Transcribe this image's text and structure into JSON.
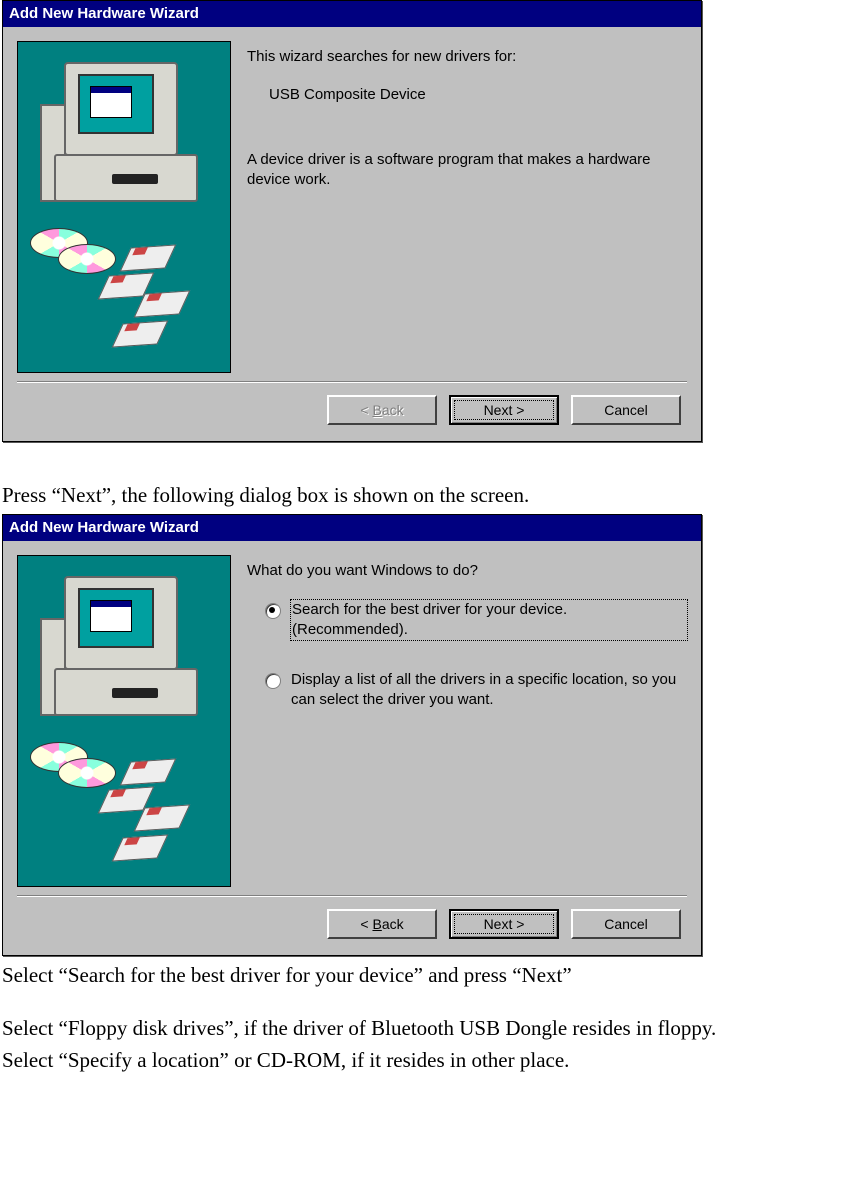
{
  "dialog1": {
    "title": "Add New Hardware Wizard",
    "line1": "This wizard searches for new drivers for:",
    "device": "USB Composite Device",
    "line2": "A device driver is a software program that makes a hardware device work.",
    "back_prefix": "< ",
    "back_u": "B",
    "back_suffix": "ack",
    "next": "Next >",
    "cancel": "Cancel"
  },
  "caption1": "Press “Next”, the following dialog box is shown on the screen.",
  "dialog2": {
    "title": "Add New Hardware Wizard",
    "question": "What do you want Windows to do?",
    "opt1": "Search for the best driver for your device. (Recommended).",
    "opt2": "Display a list of all the drivers in a specific location, so you can select the driver you want.",
    "back_prefix": "< ",
    "back_u": "B",
    "back_suffix": "ack",
    "next": "Next >",
    "cancel": "Cancel"
  },
  "caption2": "Select “Search for the best driver for your device” and press “Next”",
  "caption3": "Select “Floppy disk drives”, if the driver of Bluetooth USB Dongle resides in floppy.",
  "caption4": "Select “Specify a location” or CD-ROM, if it resides in other place."
}
